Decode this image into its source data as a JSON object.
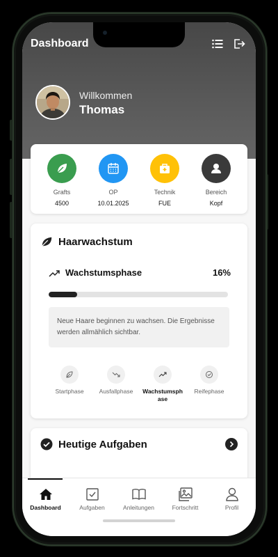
{
  "header": {
    "title": "Dashboard",
    "list_icon": "list-icon",
    "logout_icon": "logout-icon"
  },
  "profile": {
    "welcome": "Willkommen",
    "name": "Thomas"
  },
  "stats": [
    {
      "label": "Grafts",
      "value": "4500",
      "icon": "leaf-icon",
      "color": "#3a9d4f"
    },
    {
      "label": "OP",
      "value": "10.01.2025",
      "icon": "calendar-icon",
      "color": "#2196f3"
    },
    {
      "label": "Technik",
      "value": "FUE",
      "icon": "medical-kit-icon",
      "color": "#ffc107"
    },
    {
      "label": "Bereich",
      "value": "Kopf",
      "icon": "person-icon",
      "color": "#3a3a3a"
    }
  ],
  "growth": {
    "title": "Haarwachstum",
    "phase_name": "Wachstumsphase",
    "percent_label": "16%",
    "progress": 0.16,
    "info": "Neue Haare beginnen zu wachsen. Die Ergebnisse werden allmählich sichtbar.",
    "phases": [
      {
        "label": "Startphase",
        "icon": "leaf-icon",
        "active": false
      },
      {
        "label": "Ausfallphase",
        "icon": "trend-down-icon",
        "active": false
      },
      {
        "label": "Wachstumsphase",
        "icon": "trend-up-icon",
        "active": true
      },
      {
        "label": "Reifephase",
        "icon": "check-circle-icon",
        "active": false
      }
    ]
  },
  "tasks": {
    "title": "Heutige Aufgaben"
  },
  "nav": [
    {
      "label": "Dashboard",
      "icon": "home-icon",
      "active": true
    },
    {
      "label": "Aufgaben",
      "icon": "checkbox-icon",
      "active": false
    },
    {
      "label": "Anleitungen",
      "icon": "book-icon",
      "active": false
    },
    {
      "label": "Fortschritt",
      "icon": "gallery-icon",
      "active": false
    },
    {
      "label": "Profil",
      "icon": "user-icon",
      "active": false
    }
  ]
}
